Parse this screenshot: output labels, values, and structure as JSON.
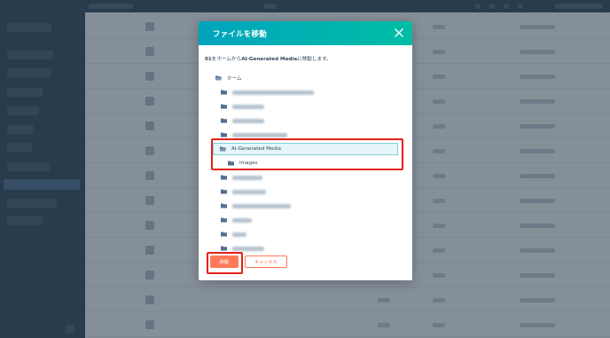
{
  "modal": {
    "title": "ファイルを移動",
    "description_file": "01",
    "description_mid": "をホームから",
    "description_target": "AI-Generated Media",
    "description_end": "に移動します。",
    "move_button": "移動",
    "cancel_button": "キャンセル"
  },
  "tree": {
    "root_label": "ホーム",
    "selected_folder": "AI-Generated Media",
    "subfolder": "Images"
  },
  "colors": {
    "header_gradient_start": "#00a4bd",
    "header_gradient_end": "#00bda5",
    "primary_button": "#ff7a59",
    "highlight": "#e4211c",
    "folder_icon": "#516f90",
    "sidebar": "#33475b"
  },
  "icons": {
    "close": "close-icon",
    "folder": "folder-icon",
    "folder_open": "folder-open-icon"
  }
}
